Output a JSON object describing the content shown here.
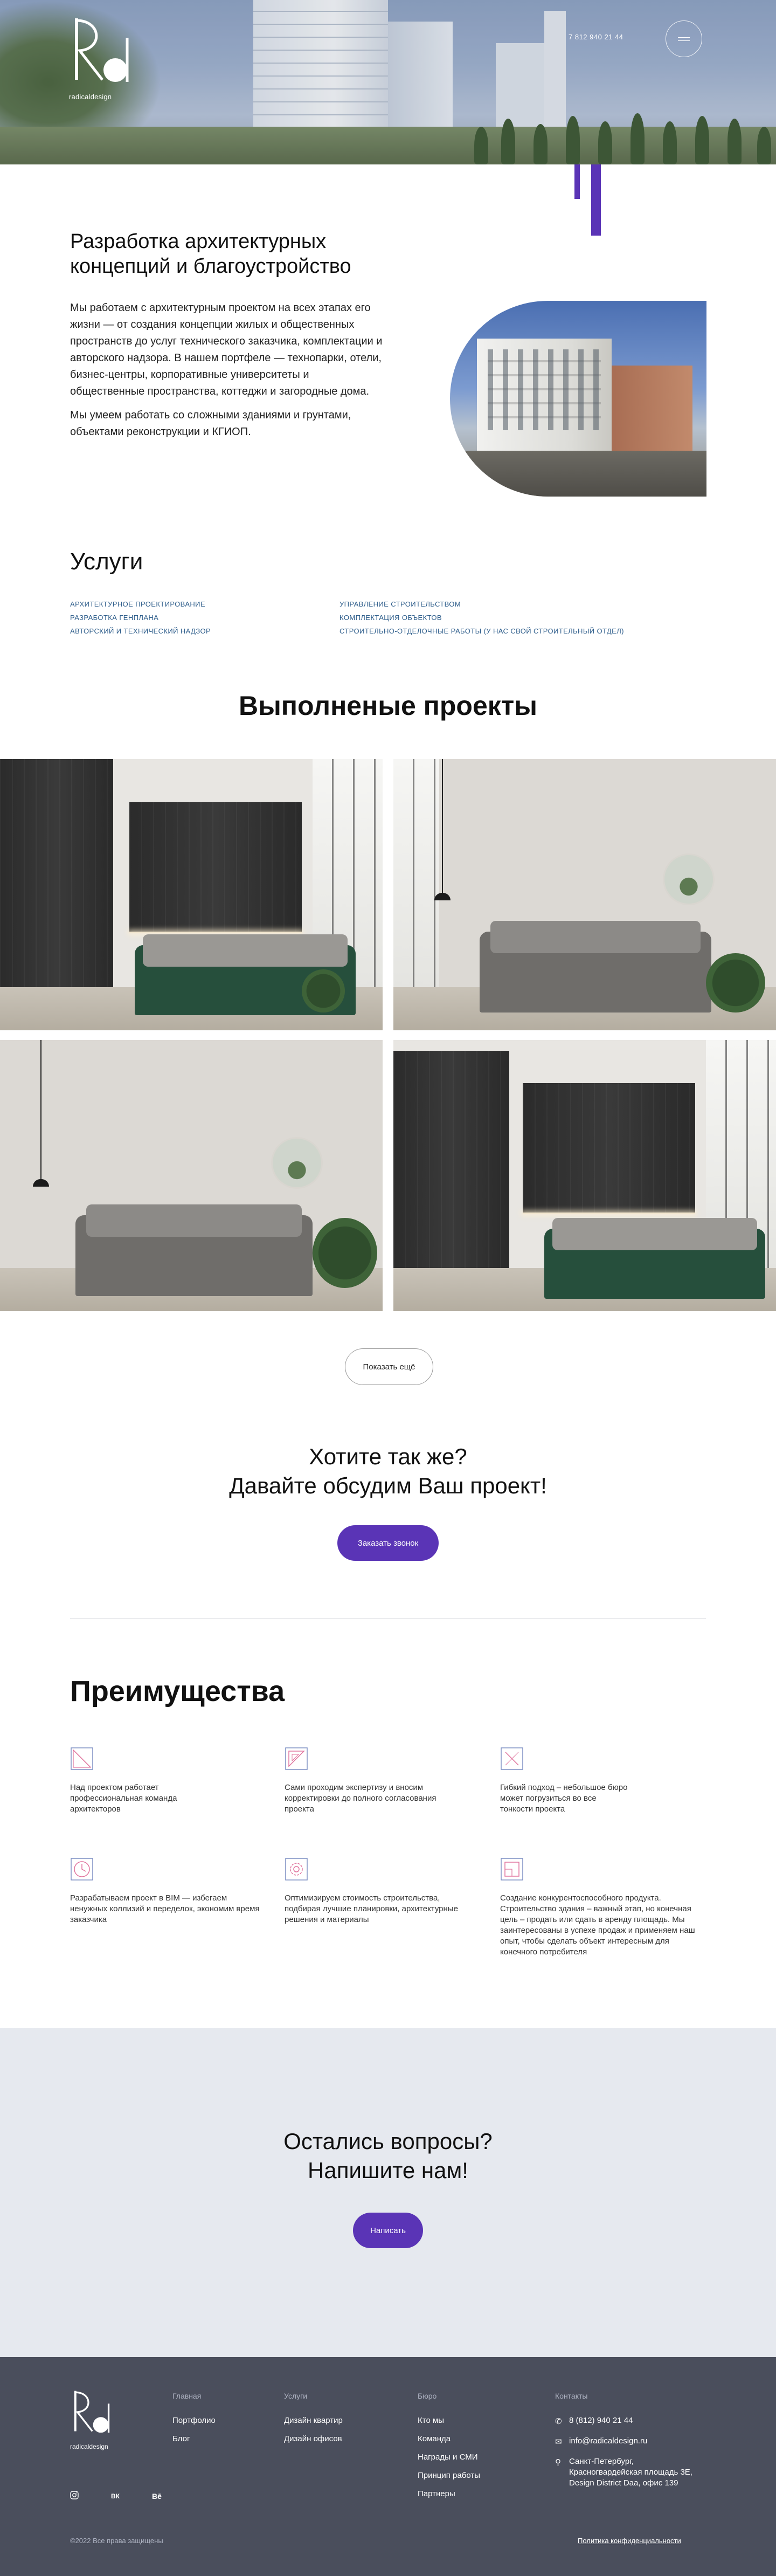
{
  "header": {
    "logo_text": "radicaldesign",
    "phone": "7 812 940 21 44"
  },
  "about": {
    "title_line1": "Разработка архитектурных",
    "title_line2": "концепций и благоустройство",
    "paragraph1": "Мы работаем с архитектурным проектом на всех этапах его жизни — от создания концепции жилых и общественных пространств до услуг технического заказчика, комплектации и авторского надзора. В нашем портфеле — технопарки, отели, бизнес-центры, корпоративные университеты и общественные пространства, коттеджи и загородные дома.",
    "paragraph2": "Мы умеем работать со сложными зданиями и грунтами, объектами реконструкции и КГИОП."
  },
  "services": {
    "title": "Услуги",
    "items": [
      "Архитектурное проектирование",
      "Разработка генплана",
      "Авторский и технический надзор",
      "Управление строительством",
      "Комплектация объектов",
      "Строительно-отделочные работы (у нас свой строительный отдел)"
    ]
  },
  "projects": {
    "title": "Выполненые проекты",
    "more_button": "Показать ещё"
  },
  "cta": {
    "title_line1": "Хотите так же?",
    "title_line2": "Давайте обсудим Ваш проект!",
    "button": "Заказать звонок"
  },
  "advantages": {
    "title": "Преимущества",
    "items": [
      {
        "text": "Над проектом работает профессиональная команда архитекторов",
        "icon": "ruler-icon"
      },
      {
        "text": "Сами проходим экспертизу и вносим корректировки до полного согласования проекта",
        "icon": "triangle-ruler-icon"
      },
      {
        "text": "Гибкий подход – небольшое бюро может погрузиться во все тонкости проекта",
        "icon": "pencil-ruler-icon"
      },
      {
        "text": "Разрабатываем проект в BIM — избегаем ненужных коллизий и переделок, экономим время заказчика",
        "icon": "clock-icon"
      },
      {
        "text": "Оптимизируем стоимость строительства, подбирая лучшие планировки, архитектурные решения и материалы",
        "icon": "gear-icon"
      },
      {
        "text": "Создание конкурентоспособного продукта. Строительство здания – важный этап, но конечная цель – продать или сдать в аренду площадь. Мы заинтересованы в успехе продаж и применяем наш опыт, чтобы сделать объект интересным для конечного потребителя",
        "icon": "plan-icon"
      }
    ]
  },
  "questions": {
    "title_line1": "Остались вопросы?",
    "title_line2": "Напишите нам!",
    "button": "Написать"
  },
  "footer": {
    "logo_text": "radicaldesign",
    "col1": {
      "head": "Главная",
      "links": [
        "Портфолио",
        "Блог"
      ]
    },
    "col2": {
      "head": "Услуги",
      "links": [
        "Дизайн квартир",
        "Дизайн офисов"
      ]
    },
    "col3": {
      "head": "Бюро",
      "links": [
        "Кто мы",
        "Команда",
        "Награды и СМИ",
        "Принцип работы",
        "Партнеры"
      ]
    },
    "contacts": {
      "head": "Контакты",
      "phone": "8 (812) 940 21 44",
      "email": "info@radicaldesign.ru",
      "address": "Санкт-Петербург, Красногвардейская площадь 3Е, Design District Daa, офис 139"
    },
    "social": {
      "vk": "ВК",
      "behance": "Bē"
    },
    "copyright": "©2022 Все права защищены",
    "privacy": "Политика конфиденциальности"
  },
  "colors": {
    "accent": "#5a34b6",
    "footer_bg": "#4a4e5c",
    "questions_bg": "#e6e9ef",
    "link": "#2c5c8a"
  }
}
